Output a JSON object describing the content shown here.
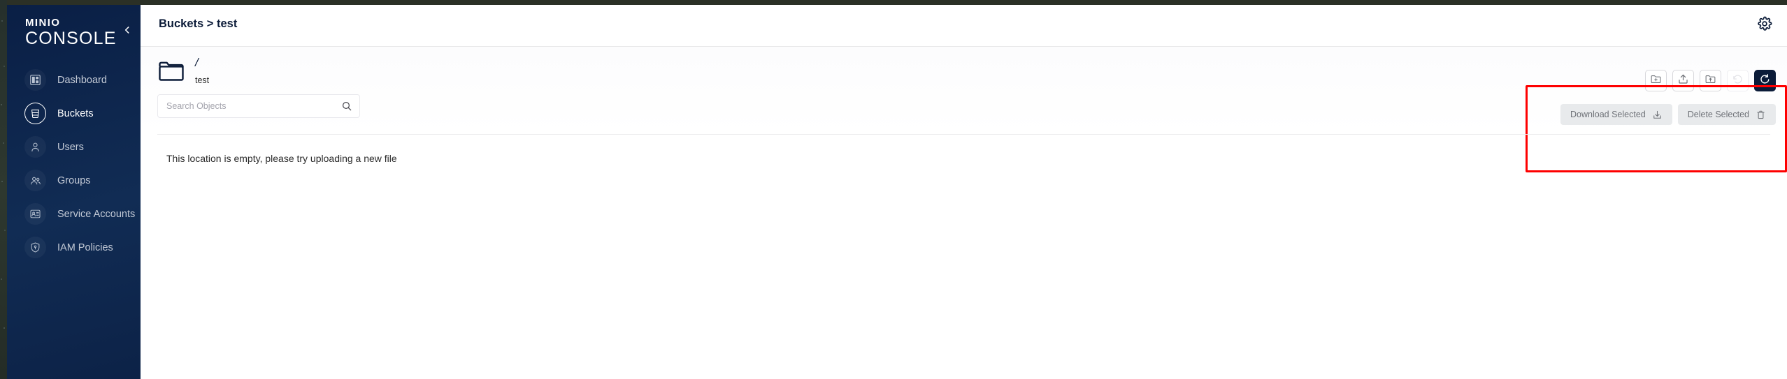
{
  "app": {
    "logo_primary": "MINIO",
    "logo_secondary": "CONSOLE",
    "collapse_icon": "chevron-left-icon",
    "settings_icon": "gear-icon"
  },
  "sidebar": {
    "items": [
      {
        "label": "Dashboard",
        "icon": "dashboard-grid-icon",
        "active": false
      },
      {
        "label": "Buckets",
        "icon": "bucket-icon",
        "active": true
      },
      {
        "label": "Users",
        "icon": "user-icon",
        "active": false
      },
      {
        "label": "Groups",
        "icon": "groups-icon",
        "active": false
      },
      {
        "label": "Service Accounts",
        "icon": "id-card-icon",
        "active": false
      },
      {
        "label": "IAM Policies",
        "icon": "shield-lock-icon",
        "active": false
      }
    ]
  },
  "header": {
    "breadcrumb": "Buckets > test"
  },
  "browser": {
    "folder_icon": "folder-icon",
    "path": "/",
    "bucket_name": "test",
    "search": {
      "placeholder": "Search Objects",
      "value": "",
      "icon": "search-icon"
    },
    "empty_message": "This location is empty, please try uploading a new file"
  },
  "toolbar": {
    "icon_buttons": [
      {
        "name": "create-new-path-button",
        "icon": "folder-plus-icon",
        "disabled": false,
        "primary": false
      },
      {
        "name": "upload-file-button",
        "icon": "upload-icon",
        "disabled": false,
        "primary": false
      },
      {
        "name": "upload-folder-button",
        "icon": "folder-up-icon",
        "disabled": false,
        "primary": false
      },
      {
        "name": "rewind-button",
        "icon": "rewind-clock-icon",
        "disabled": true,
        "primary": false
      },
      {
        "name": "refresh-button",
        "icon": "refresh-icon",
        "disabled": false,
        "primary": true
      }
    ],
    "download_selected_label": "Download Selected",
    "download_selected_icon": "download-icon",
    "delete_selected_label": "Delete Selected",
    "delete_selected_icon": "trash-icon"
  },
  "annotation": {
    "highlight_color": "#fe0000"
  },
  "colors": {
    "sidebar_bg": "#0d2347",
    "primary": "#0b1b38",
    "disabled_button_bg": "#e8eaec",
    "muted_text": "#6f7278"
  }
}
